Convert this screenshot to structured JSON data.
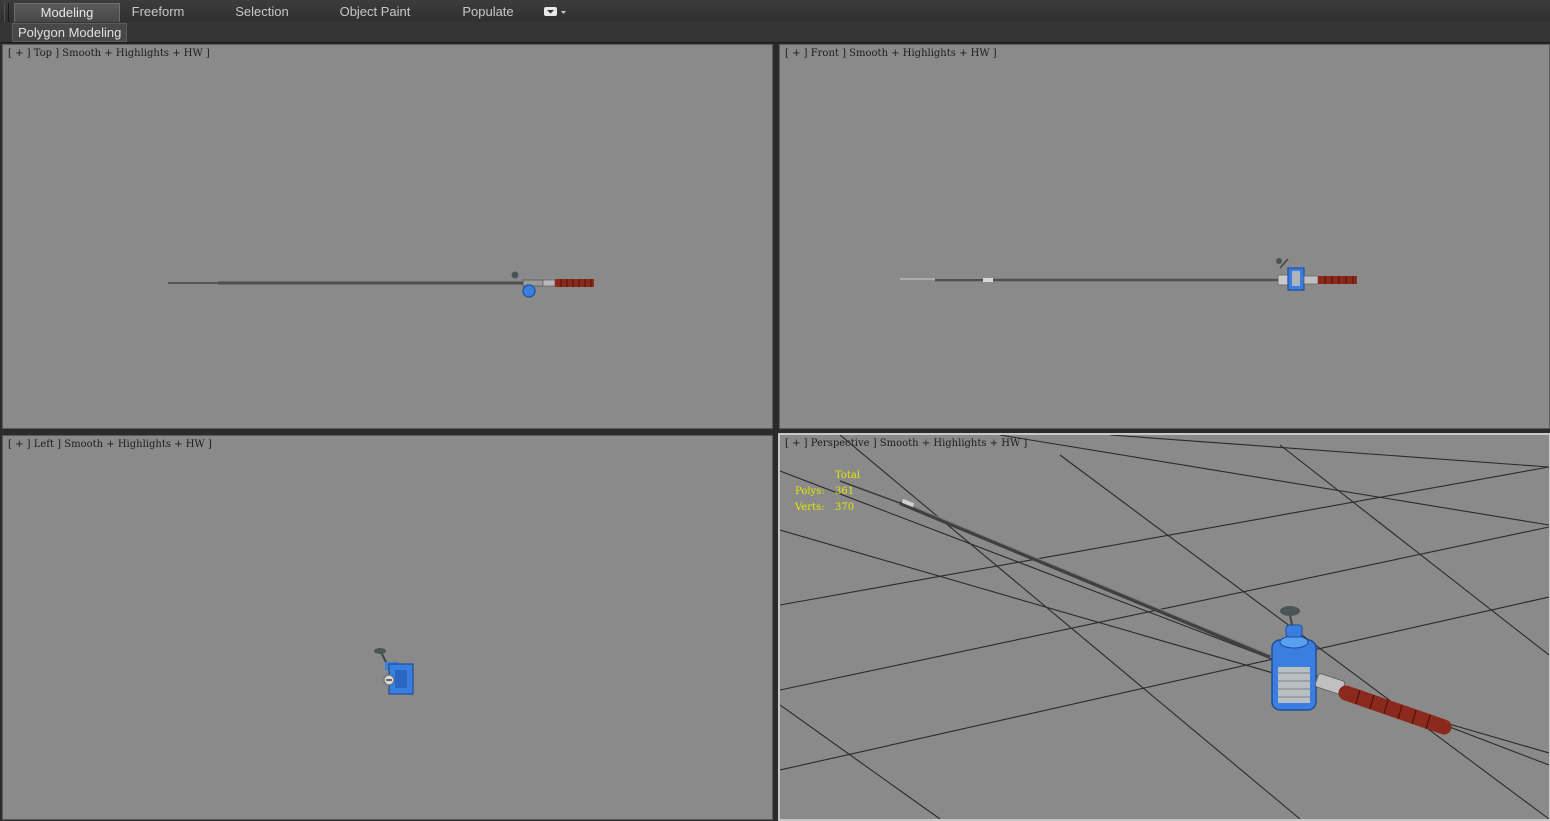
{
  "ribbon": {
    "tabs": [
      {
        "label": "Modeling",
        "active": true
      },
      {
        "label": "Freeform",
        "active": false
      },
      {
        "label": "Selection",
        "active": false
      },
      {
        "label": "Object Paint",
        "active": false
      },
      {
        "label": "Populate",
        "active": false
      }
    ],
    "panel_label": "Polygon Modeling"
  },
  "viewports": {
    "top": {
      "label": "[ + ] Top ] Smooth + Highlights + HW ]"
    },
    "front": {
      "label": "[ + ] Front ] Smooth + Highlights + HW ]"
    },
    "left": {
      "label": "[ + ] Left ] Smooth + Highlights + HW ]"
    },
    "perspective": {
      "label": "[ + ] Perspective ] Smooth + Highlights + HW ]",
      "stats": {
        "header": "Total",
        "polys_label": "Polys:",
        "polys_value": "361",
        "verts_label": "Verts:",
        "verts_value": "370"
      }
    }
  },
  "colors": {
    "viewport_bg": "#8a8a8a",
    "reel_blue": "#3a7fe0",
    "handle_red": "#8b2a1c",
    "rod_gray": "#555555",
    "stats_yellow": "#e6e600"
  }
}
